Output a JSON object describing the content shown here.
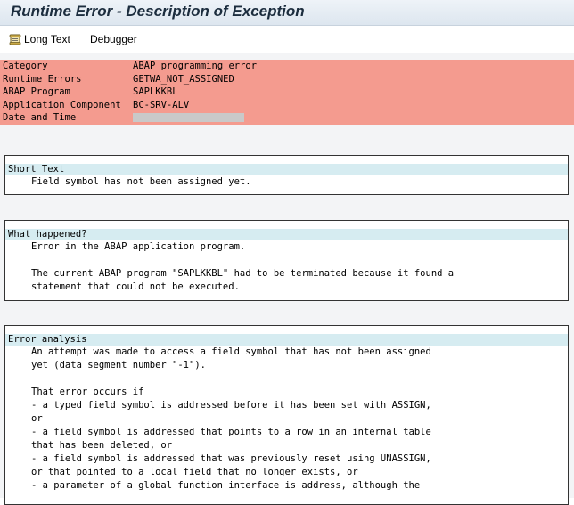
{
  "title": "Runtime Error - Description of Exception",
  "toolbar": {
    "long_text": "Long Text",
    "debugger": "Debugger"
  },
  "header": {
    "category_label": "Category",
    "category_value": "ABAP programming error",
    "runtime_errors_label": "Runtime Errors",
    "runtime_errors_value": "GETWA_NOT_ASSIGNED",
    "abap_program_label": "ABAP Program",
    "abap_program_value": "SAPLKKBL",
    "application_component_label": "Application Component",
    "application_component_value": "BC-SRV-ALV",
    "date_time_label": "Date and Time"
  },
  "short_text": {
    "heading": "Short Text",
    "lines": [
      "Field symbol has not been assigned yet."
    ]
  },
  "what_happened": {
    "heading": "What happened?",
    "line1": "Error in the ABAP application program.",
    "line2": "The current ABAP program \"SAPLKKBL\" had to be terminated because it found a",
    "line3": "statement that could not be executed."
  },
  "error_analysis": {
    "heading": "Error analysis",
    "line1": "An attempt was made to access a field symbol that has not been assigned",
    "line2": "yet (data segment number \"-1\").",
    "line3": "That error occurs if",
    "line4": "- a typed field symbol is addressed before it has been set with ASSIGN,",
    "line5": "or",
    "line6": "- a field symbol is addressed that points to a row in an internal table",
    "line7": "that has been deleted, or",
    "line8": "- a field symbol is addressed that was previously reset using UNASSIGN,",
    "line9": "or that pointed to a local field that no longer exists, or",
    "line10": "- a parameter of a global function interface is address, although the"
  },
  "colors": {
    "header_row_bg": "#f49b8f",
    "section_heading_bg": "#d6ecf1",
    "body_bg": "#f3f4f6"
  }
}
